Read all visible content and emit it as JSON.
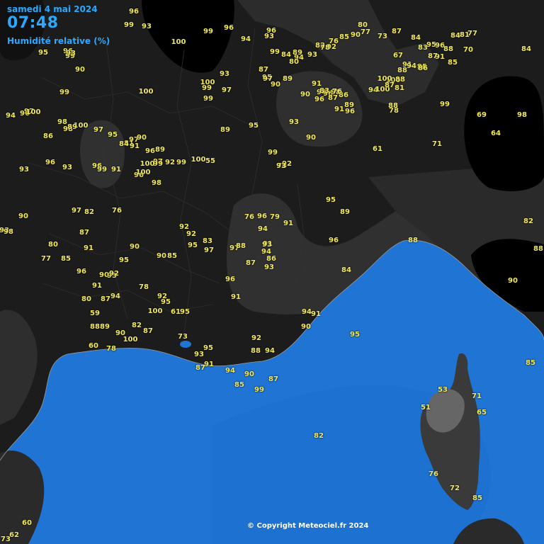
{
  "header": {
    "date": "samedi 4 mai 2024",
    "time": "07:48",
    "variable": "Humidité relative (%)"
  },
  "copyright": "© Copyright Meteociel.fr 2024",
  "colors": {
    "sea": "#1f74d4",
    "land_dark": "#1c1c1c",
    "land_mid": "#333333",
    "land_light": "#555555",
    "very_humid": "#000000",
    "label": "#f0e85a",
    "header": "#29a9ff"
  },
  "observations": [
    "96",
    "99",
    "93",
    "99",
    "96",
    "100",
    "99",
    "96",
    "94",
    "93",
    "99",
    "100",
    "96",
    "99",
    "98",
    "96",
    "99",
    "100",
    "93",
    "97",
    "87",
    "90",
    "95",
    "97",
    "89",
    "94",
    "84",
    "80",
    "89",
    "93",
    "91",
    "96",
    "90",
    "94",
    "96",
    "98",
    "86",
    "89",
    "96",
    "91",
    "87",
    "83",
    "76",
    "99",
    "90",
    "93",
    "60",
    "62",
    "73",
    "65",
    "53",
    "51",
    "71",
    "82",
    "76",
    "72",
    "85",
    "85",
    "92",
    "82",
    "76",
    "85",
    "78",
    "80",
    "90",
    "77",
    "73",
    "87",
    "84",
    "83",
    "95",
    "96",
    "88",
    "85",
    "91",
    "76",
    "87",
    "84",
    "81",
    "77",
    "70",
    "84",
    "67",
    "91",
    "85",
    "86",
    "94",
    "88",
    "100",
    "88",
    "100",
    "94",
    "100",
    "87",
    "81",
    "78",
    "88",
    "99",
    "71",
    "69",
    "64",
    "98",
    "61",
    "90",
    "93",
    "95",
    "89",
    "99",
    "76",
    "92",
    "93",
    "55",
    "100",
    "99",
    "92",
    "97",
    "99",
    "96",
    "100",
    "100",
    "98",
    "89",
    "97",
    "81",
    "91",
    "90",
    "84",
    "95",
    "97",
    "100",
    "96",
    "99",
    "91",
    "93",
    "93",
    "96",
    "86",
    "98",
    "89",
    "96",
    "97",
    "100",
    "94",
    "95",
    "90",
    "93",
    "98",
    "97",
    "82",
    "76",
    "87",
    "91",
    "80",
    "85",
    "77",
    "96",
    "90",
    "93",
    "92",
    "91",
    "80",
    "87",
    "94",
    "90",
    "95",
    "78",
    "90",
    "85",
    "92",
    "92",
    "95",
    "83",
    "97",
    "97",
    "88",
    "87",
    "91",
    "94",
    "86",
    "93",
    "96",
    "91",
    "94",
    "93",
    "96",
    "79",
    "76",
    "91",
    "95",
    "89",
    "96",
    "84",
    "88",
    "82",
    "88",
    "90",
    "94",
    "91",
    "90",
    "95",
    "92",
    "88",
    "94",
    "94",
    "90",
    "85",
    "99",
    "87",
    "91",
    "87",
    "93",
    "95",
    "73",
    "61",
    "95",
    "95",
    "92",
    "100",
    "82",
    "87",
    "90",
    "100",
    "78",
    "88",
    "89",
    "59",
    "60"
  ]
}
